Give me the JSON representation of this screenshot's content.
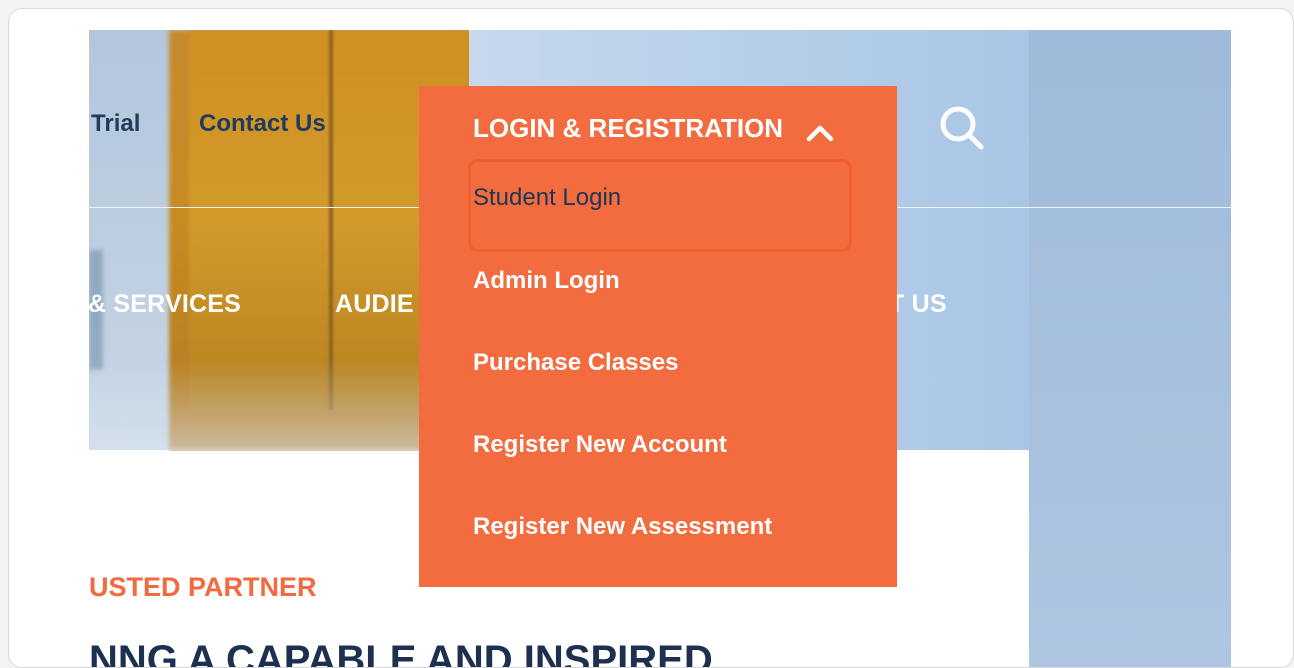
{
  "top_nav": {
    "trial_partial": "e Trial",
    "contact_us": "Contact Us"
  },
  "main_nav": {
    "services_partial": "& SERVICES",
    "audience_partial": "AUDIE",
    "about_partial": "T US"
  },
  "dropdown": {
    "title": "LOGIN & REGISTRATION",
    "items": [
      {
        "label": "Student Login"
      },
      {
        "label": "Admin Login"
      },
      {
        "label": "Purchase Classes"
      },
      {
        "label": "Register New Account"
      },
      {
        "label": "Register New Assessment"
      }
    ]
  },
  "content": {
    "eyebrow_partial": "USTED PARTNER",
    "headline_partial": "NNG A CAPABLE AND INSPIRED"
  },
  "colors": {
    "accent_orange": "#f26c3f",
    "navy": "#1f3b5e",
    "white": "#ffffff"
  },
  "icons": {
    "search": "search-icon",
    "chevron": "chevron-up-icon"
  }
}
